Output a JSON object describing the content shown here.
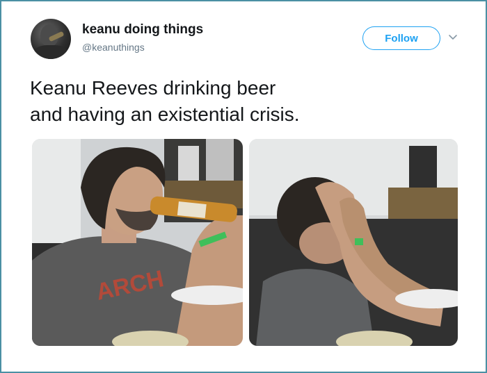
{
  "tweet": {
    "user": {
      "display_name": "keanu doing things",
      "handle": "@keanuthings"
    },
    "follow_label": "Follow",
    "text_lines": [
      "Keanu Reeves drinking beer",
      "and having an existential crisis."
    ]
  },
  "media": [
    {
      "icon": "photo-man-drinking-beer"
    },
    {
      "icon": "photo-man-face-in-hands"
    }
  ],
  "colors": {
    "accent": "#1da1f2",
    "frame_border": "#4a90a4",
    "text": "#14171a",
    "muted": "#657786"
  }
}
